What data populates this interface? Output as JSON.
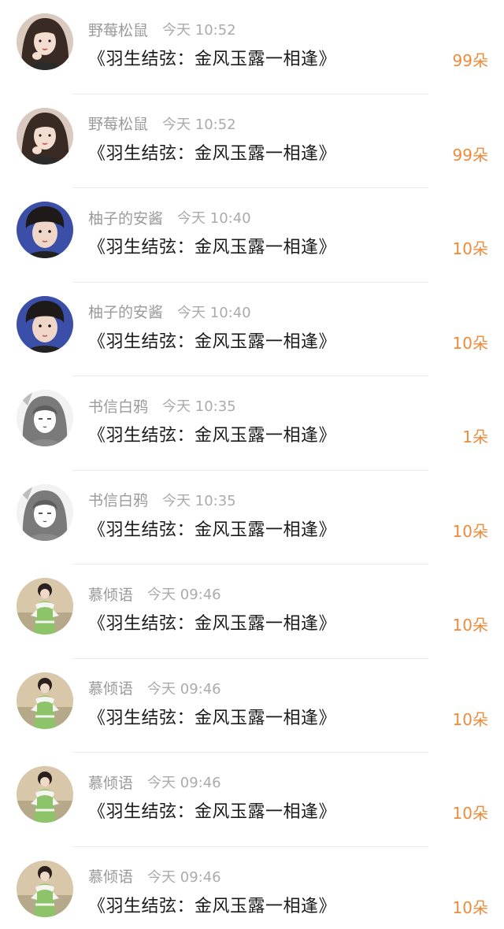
{
  "items": [
    {
      "name": "野莓松鼠",
      "time": "今天 10:52",
      "title": "《羽生结弦：金风玉露一相逢》",
      "count": "99朵",
      "avatar": "girl-avatar-icon"
    },
    {
      "name": "野莓松鼠",
      "time": "今天 10:52",
      "title": "《羽生结弦：金风玉露一相逢》",
      "count": "99朵",
      "avatar": "girl-avatar-icon"
    },
    {
      "name": "柚子的安酱",
      "time": "今天 10:40",
      "title": "《羽生结弦：金风玉露一相逢》",
      "count": "10朵",
      "avatar": "boy-avatar-icon"
    },
    {
      "name": "柚子的安酱",
      "time": "今天 10:40",
      "title": "《羽生结弦：金风玉露一相逢》",
      "count": "10朵",
      "avatar": "boy-avatar-icon"
    },
    {
      "name": "书信白鸦",
      "time": "今天 10:35",
      "title": "《羽生结弦：金风玉露一相逢》",
      "count": "1朵",
      "avatar": "manga-avatar-icon"
    },
    {
      "name": "书信白鸦",
      "time": "今天 10:35",
      "title": "《羽生结弦：金风玉露一相逢》",
      "count": "10朵",
      "avatar": "manga-avatar-icon"
    },
    {
      "name": "慕倾语",
      "time": "今天 09:46",
      "title": "《羽生结弦：金风玉露一相逢》",
      "count": "10朵",
      "avatar": "costume-avatar-icon"
    },
    {
      "name": "慕倾语",
      "time": "今天 09:46",
      "title": "《羽生结弦：金风玉露一相逢》",
      "count": "10朵",
      "avatar": "costume-avatar-icon"
    },
    {
      "name": "慕倾语",
      "time": "今天 09:46",
      "title": "《羽生结弦：金风玉露一相逢》",
      "count": "10朵",
      "avatar": "costume-avatar-icon"
    },
    {
      "name": "慕倾语",
      "time": "今天 09:46",
      "title": "《羽生结弦：金风玉露一相逢》",
      "count": "10朵",
      "avatar": "costume-avatar-icon"
    }
  ],
  "colors": {
    "count": "#ef8a3a",
    "name": "#9a9a9a",
    "title": "#1a1a1a"
  }
}
